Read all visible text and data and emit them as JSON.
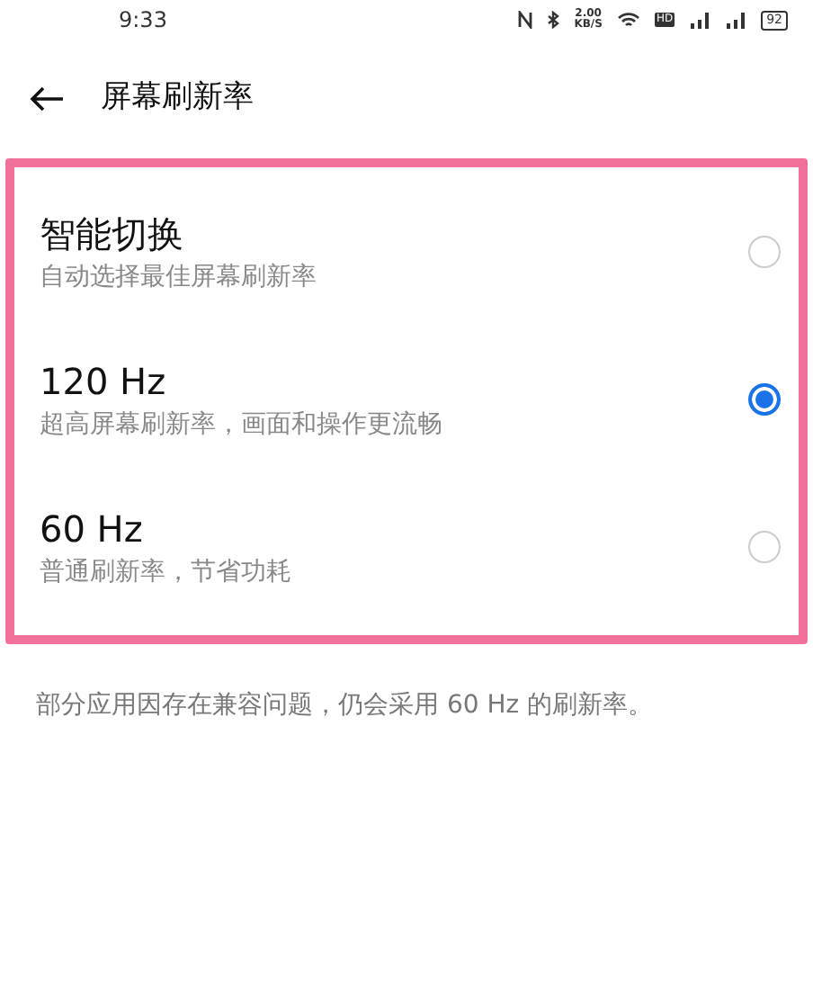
{
  "status_bar": {
    "time": "9:33",
    "net_speed": "2.00",
    "net_unit": "KB/S",
    "hd": "HD",
    "battery": "92"
  },
  "header": {
    "title": "屏幕刷新率"
  },
  "options": [
    {
      "title": "智能切换",
      "subtitle": "自动选择最佳屏幕刷新率",
      "selected": false
    },
    {
      "title": "120 Hz",
      "subtitle": "超高屏幕刷新率，画面和操作更流畅",
      "selected": true
    },
    {
      "title": "60 Hz",
      "subtitle": "普通刷新率，节省功耗",
      "selected": false
    }
  ],
  "footnote": "部分应用因存在兼容问题，仍会采用 60 Hz 的刷新率。"
}
